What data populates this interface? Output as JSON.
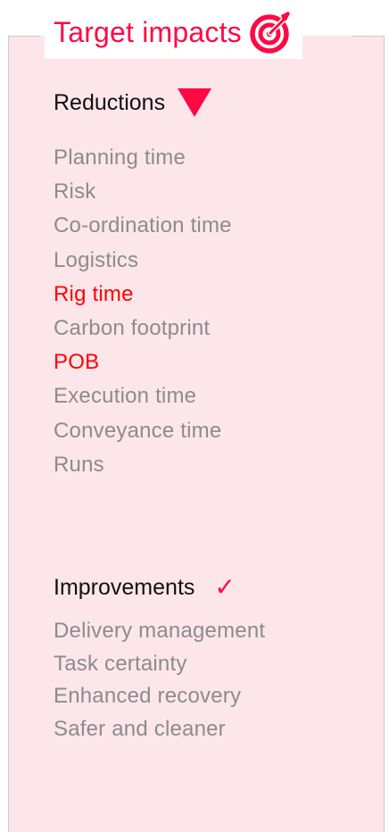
{
  "header": {
    "title": "Target impacts",
    "icon": "target-icon",
    "accent_color": "#ff0844"
  },
  "reductions": {
    "heading": "Reductions",
    "icon": "down-triangle-icon",
    "items": [
      {
        "label": "Planning time",
        "highlight": false
      },
      {
        "label": "Risk",
        "highlight": false
      },
      {
        "label": "Co-ordination time",
        "highlight": false
      },
      {
        "label": "Logistics",
        "highlight": false
      },
      {
        "label": "Rig time",
        "highlight": true
      },
      {
        "label": "Carbon footprint",
        "highlight": false
      },
      {
        "label": "POB",
        "highlight": true
      },
      {
        "label": "Execution time",
        "highlight": false
      },
      {
        "label": "Conveyance time",
        "highlight": false
      },
      {
        "label": "Runs",
        "highlight": false
      }
    ]
  },
  "improvements": {
    "heading": "Improvements",
    "icon": "checkmark-icon",
    "items": [
      {
        "label": "Delivery management",
        "highlight": false
      },
      {
        "label": "Task certainty",
        "highlight": false
      },
      {
        "label": "Enhanced recovery",
        "highlight": false
      },
      {
        "label": "Safer and cleaner",
        "highlight": false
      }
    ]
  },
  "colors": {
    "panel_background": "#fde6ea",
    "item_text": "#8c8c8c",
    "item_highlight": "#ff0000",
    "heading_text": "#111111"
  }
}
